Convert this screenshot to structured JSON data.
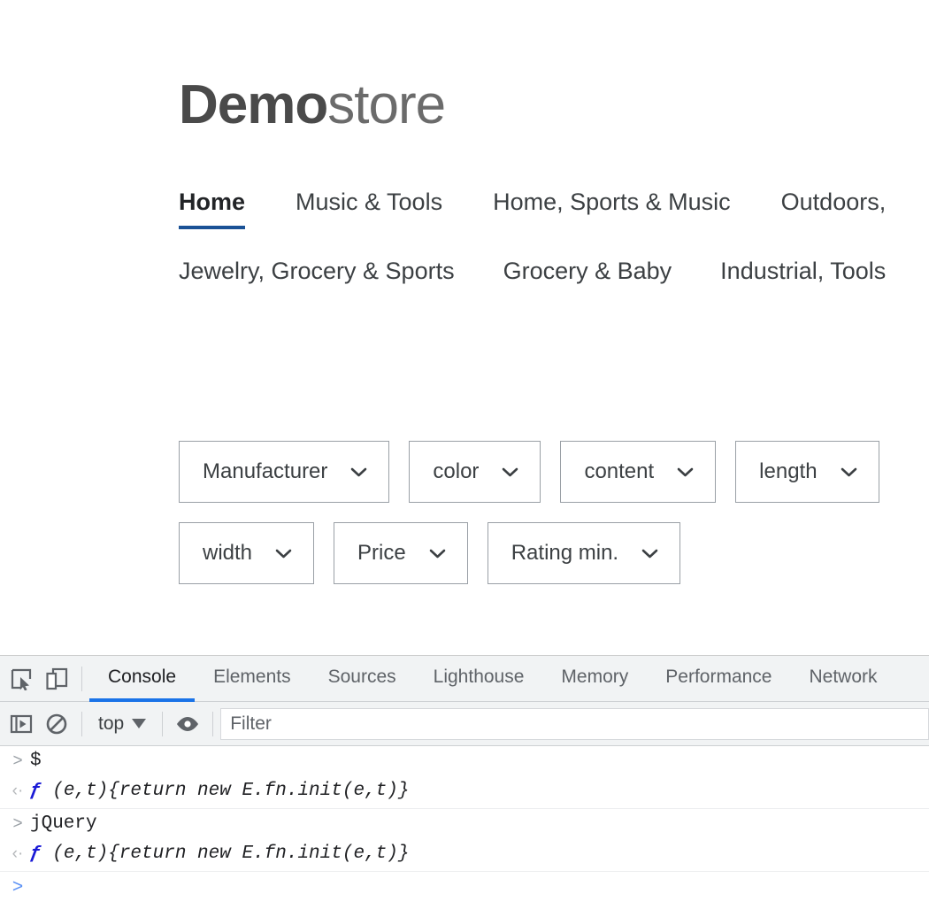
{
  "store": {
    "logo": {
      "bold": "Demo",
      "light": "store"
    },
    "nav_row_1": [
      {
        "label": "Home",
        "active": true
      },
      {
        "label": "Music & Tools",
        "active": false
      },
      {
        "label": "Home, Sports & Music",
        "active": false
      },
      {
        "label": "Outdoors,",
        "active": false
      }
    ],
    "nav_row_2": [
      {
        "label": "Jewelry, Grocery & Sports"
      },
      {
        "label": "Grocery & Baby"
      },
      {
        "label": "Industrial, Tools"
      }
    ],
    "filters_row_1": [
      {
        "label": "Manufacturer"
      },
      {
        "label": "color"
      },
      {
        "label": "content"
      },
      {
        "label": "length"
      }
    ],
    "filters_row_2": [
      {
        "label": "width"
      },
      {
        "label": "Price"
      },
      {
        "label": "Rating min."
      }
    ],
    "accent_color": "#1a5296"
  },
  "devtools": {
    "inspect_icon": "inspect-element-icon",
    "device_icon": "device-toolbar-icon",
    "tabs": [
      {
        "label": "Console",
        "active": true
      },
      {
        "label": "Elements",
        "active": false
      },
      {
        "label": "Sources",
        "active": false
      },
      {
        "label": "Lighthouse",
        "active": false
      },
      {
        "label": "Memory",
        "active": false
      },
      {
        "label": "Performance",
        "active": false
      },
      {
        "label": "Network",
        "active": false
      }
    ],
    "accent_color": "#1a73e8",
    "console_toolbar": {
      "sidebar_icon": "show-console-sidebar-icon",
      "clear_icon": "clear-console-icon",
      "context": "top",
      "eye_icon": "create-live-expression-icon",
      "filter_placeholder": "Filter",
      "filter_value": ""
    },
    "console_rows": [
      {
        "kind": "input",
        "marker": ">",
        "text": "$"
      },
      {
        "kind": "result",
        "marker": "‹·",
        "fn": "ƒ",
        "text": " (e,t){return new E.fn.init(e,t)}"
      },
      {
        "kind": "input",
        "marker": ">",
        "text": "jQuery"
      },
      {
        "kind": "result",
        "marker": "‹·",
        "fn": "ƒ",
        "text": " (e,t){return new E.fn.init(e,t)}"
      },
      {
        "kind": "prompt",
        "marker": ">",
        "text": ""
      }
    ]
  }
}
